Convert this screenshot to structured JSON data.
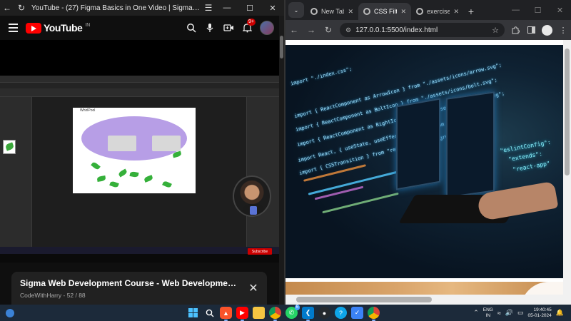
{
  "youtube_window": {
    "title": "YouTube - (27) Figma Basics in One Video | Sigma Web Develop...",
    "logo_text": "YouTube",
    "logo_country": "IN",
    "notification_count": "9+",
    "playlist": {
      "title": "Sigma Web Development Course - Web Development T...",
      "channel_progress": "CodeWithHarry - 52 / 88"
    },
    "video": {
      "frame_nav_title": "WhirlPool",
      "subscribe_label": "Subscribe"
    }
  },
  "chrome_window": {
    "tabs": [
      {
        "label": "New Tab",
        "active": false
      },
      {
        "label": "CSS Filte",
        "active": true
      },
      {
        "label": "exercise",
        "active": false
      }
    ],
    "url": "127.0.0.1:5500/index.html",
    "hero_code_lines": [
      "import \"./index.css\";",
      "import { ReactComponent as ArrowIcon } from \"./assets/icons/arrow.svg\";",
      "import { ReactComponent as BoltIcon } from \"./assets/icons/bolt.svg\";",
      "import { ReactComponent as RightIcon } from \"./assets/icons/right.svg\";",
      "import React, { useState, useEffect, useRef } from \"react\";",
      "import { CSSTransition } from \"react-transition-group\";"
    ],
    "holo_tags": [
      "\"eslintConfig\":",
      "\"extends\":",
      "\"react-app\""
    ]
  },
  "taskbar": {
    "whatsapp_badge": "5",
    "tray": {
      "lang_top": "ENG",
      "lang_bottom": "IN",
      "time": "19:40:45",
      "date": "05-01-2024"
    }
  },
  "colors": {
    "youtube_red": "#ff0000",
    "chrome_dark": "#202124",
    "taskbar": "#1c2a3a",
    "figma_ellipse": "#b79ee6"
  },
  "icons": {
    "back": "back-arrow-icon",
    "reload": "reload-icon",
    "menu": "hamburger-icon",
    "search": "search-icon",
    "mic": "microphone-icon",
    "create": "create-video-icon",
    "bell": "bell-icon",
    "close": "close-icon",
    "star": "star-icon",
    "extensions": "puzzle-icon",
    "sidepanel": "side-panel-icon"
  }
}
